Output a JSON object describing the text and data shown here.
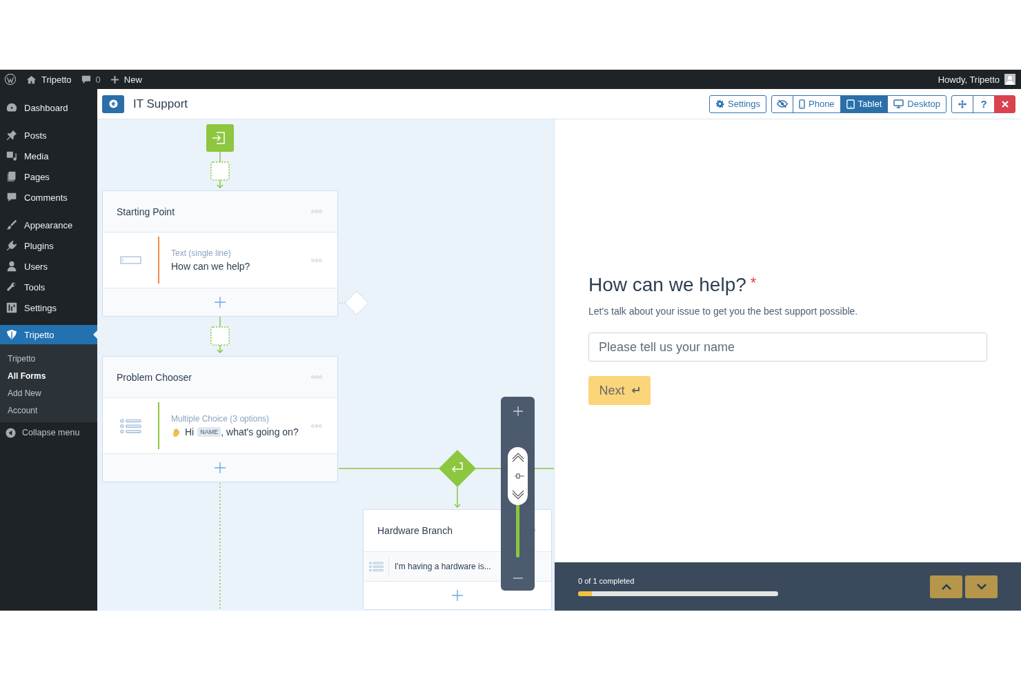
{
  "admin_bar": {
    "site": "Tripetto",
    "comments": "0",
    "new": "New",
    "greeting": "Howdy, Tripetto"
  },
  "sidebar": {
    "groups": [
      {
        "items": [
          {
            "label": "Dashboard",
            "selected": false
          }
        ]
      },
      {
        "items": [
          {
            "label": "Posts",
            "selected": false
          },
          {
            "label": "Media",
            "selected": false
          },
          {
            "label": "Pages",
            "selected": false
          },
          {
            "label": "Comments",
            "selected": false
          }
        ]
      },
      {
        "items": [
          {
            "label": "Appearance",
            "selected": false
          },
          {
            "label": "Plugins",
            "selected": false
          },
          {
            "label": "Users",
            "selected": false
          },
          {
            "label": "Tools",
            "selected": false
          },
          {
            "label": "Settings",
            "selected": false
          }
        ]
      },
      {
        "items": [
          {
            "label": "Tripetto",
            "selected": true,
            "submenu": [
              {
                "label": "Tripetto",
                "selected": false
              },
              {
                "label": "All Forms",
                "selected": true
              },
              {
                "label": "Add New",
                "selected": false
              },
              {
                "label": "Account",
                "selected": false
              }
            ]
          }
        ]
      }
    ],
    "collapse": "Collapse menu"
  },
  "header": {
    "title": "IT Support",
    "settings": "Settings",
    "devices": [
      {
        "label": "Phone",
        "selected": false
      },
      {
        "label": "Tablet",
        "selected": true
      },
      {
        "label": "Desktop",
        "selected": false
      }
    ],
    "help": "?"
  },
  "canvas": {
    "sections": [
      {
        "title": "Starting Point",
        "block": {
          "kind": "text",
          "type_label": "Text (single line)",
          "text": "How can we help?",
          "color": "#f08a4b"
        }
      },
      {
        "title": "Problem Chooser",
        "block": {
          "kind": "choice",
          "type_label": "Multiple Choice (3 options)",
          "text_before": "Hi",
          "variable": "NAME",
          "text_after": ", what's going on?",
          "color": "#8dc63f"
        }
      }
    ],
    "branch": {
      "title": "Hardware Branch",
      "block_text": "I'm having a hardware is..."
    }
  },
  "preview": {
    "question": "How can we help?",
    "required_mark": "*",
    "description": "Let's talk about your issue to get you the best support possible.",
    "input": {
      "placeholder": "Please tell us your name"
    },
    "next": "Next",
    "progress": {
      "label": "0 of 1 completed",
      "level": 0.07
    }
  }
}
